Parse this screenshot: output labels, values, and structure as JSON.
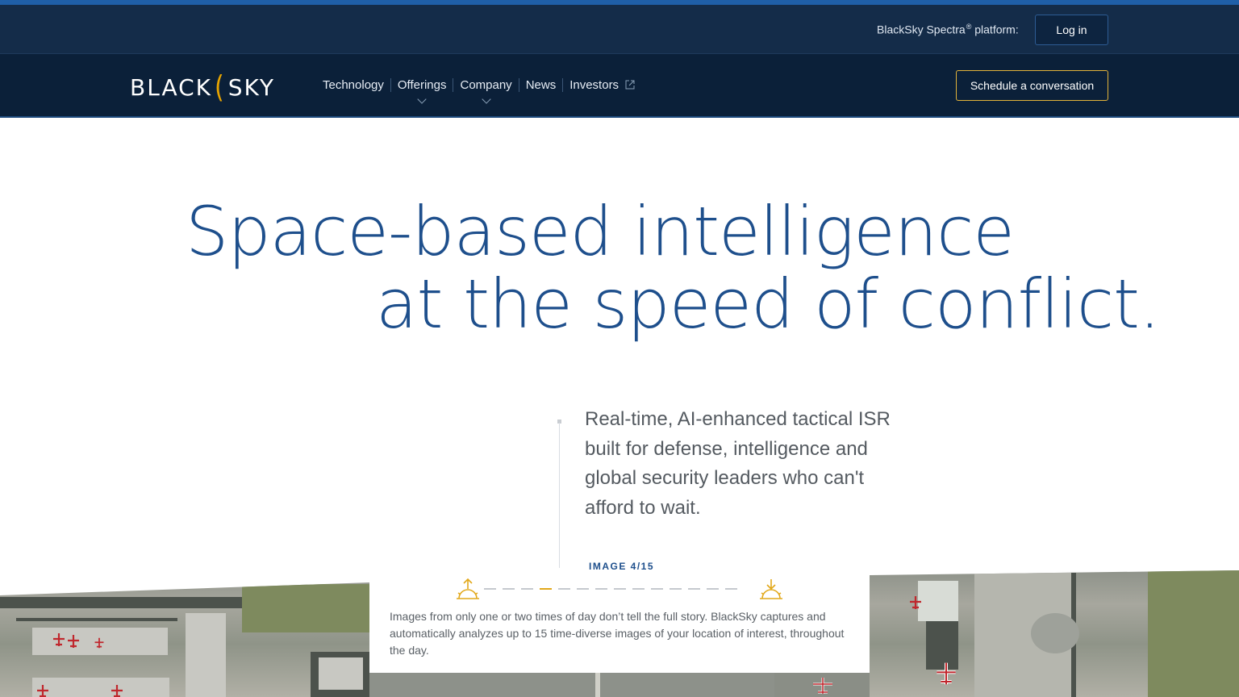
{
  "topbar": {
    "platform_label": "BlackSky Spectra",
    "platform_suffix": " platform:",
    "registered": "®",
    "login_label": "Log in"
  },
  "nav": {
    "logo_left": "BLACK",
    "logo_right": "SKY",
    "items": [
      {
        "label": "Technology"
      },
      {
        "label": "Offerings"
      },
      {
        "label": "Company"
      },
      {
        "label": "News"
      },
      {
        "label": "Investors"
      }
    ],
    "cta_label": "Schedule a conversation"
  },
  "hero": {
    "line1": "Space-based intelligence",
    "line2": "at the speed of conflict.",
    "subcopy": "Real-time, AI-enhanced tactical ISR built for defense, intelligence and global security leaders who can't afford to wait."
  },
  "timeline": {
    "image_counter": "IMAGE 4/15",
    "current": 4,
    "total": 15,
    "description": "Images from only one or two times of day don’t tell the full story. BlackSky captures and automatically analyzes up to 15 time-diverse images of your location of interest, throughout the day."
  },
  "colors": {
    "accent": "#1f5fa8",
    "nav_bg": "#0b2039",
    "util_bg": "#142c49",
    "hero_text": "#1e4f8c",
    "gold": "#e2a81a"
  }
}
